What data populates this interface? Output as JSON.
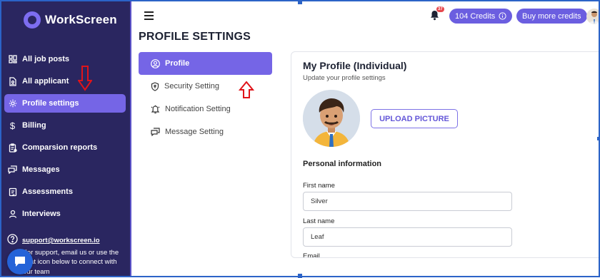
{
  "app": {
    "name": "WorkScreen"
  },
  "sidebar": {
    "items": [
      {
        "label": "All job posts",
        "icon": "grid-icon"
      },
      {
        "label": "All applicant",
        "icon": "document-person-icon"
      },
      {
        "label": "Profile settings",
        "icon": "gear-icon",
        "active": true
      },
      {
        "label": "Billing",
        "icon": "dollar-icon"
      },
      {
        "label": "Comparsion reports",
        "icon": "report-icon"
      },
      {
        "label": "Messages",
        "icon": "messages-icon"
      },
      {
        "label": "Assessments",
        "icon": "assessment-icon"
      },
      {
        "label": "Interviews",
        "icon": "person-icon"
      }
    ],
    "support_email": "support@workscreen.io",
    "support_text": "For support, email us or use the chat icon below to connect with our team"
  },
  "header": {
    "page_title": "PROFILE SETTINGS",
    "notification_count": "37",
    "credits_label": "104 Credits",
    "buy_label": "Buy more credits"
  },
  "settings_nav": [
    {
      "label": "Profile",
      "icon": "user-circle-icon",
      "active": true
    },
    {
      "label": "Security Setting",
      "icon": "shield-icon"
    },
    {
      "label": "Notification Setting",
      "icon": "bell-icon"
    },
    {
      "label": "Message Setting",
      "icon": "messages-icon"
    }
  ],
  "profile": {
    "title": "My Profile (Individual)",
    "subtitle": "Update your profile settings",
    "upload_label": "UPLOAD PICTURE",
    "section_title": "Personal information",
    "fields": [
      {
        "label": "First name",
        "value": "Silver"
      },
      {
        "label": "Last name",
        "value": "Leaf"
      },
      {
        "label": "Email",
        "value": ""
      }
    ]
  },
  "colors": {
    "sidebar_bg": "#2a2660",
    "accent": "#7565e6",
    "annotation_red": "#e0141a"
  }
}
